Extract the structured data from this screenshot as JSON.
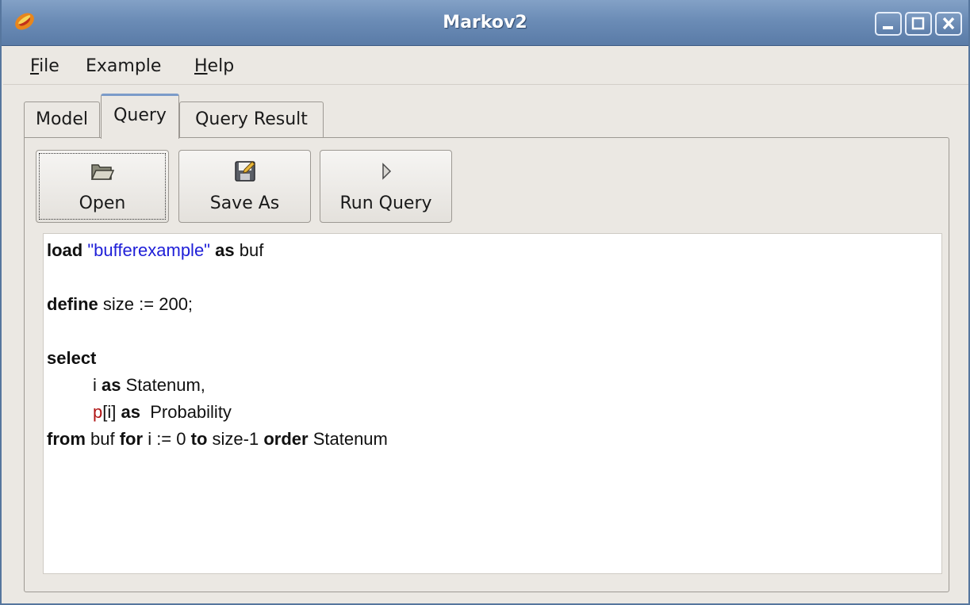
{
  "window": {
    "title": "Markov2",
    "icon": "markov-app-icon",
    "controls": [
      "minimize-icon",
      "maximize-icon",
      "close-icon"
    ]
  },
  "menu": {
    "file": {
      "mnemonic": "F",
      "rest": "ile"
    },
    "example": "Example",
    "help": {
      "mnemonic": "H",
      "rest": "elp"
    }
  },
  "tabs": {
    "model": "Model",
    "query": "Query",
    "query_result": "Query Result",
    "active": "Query"
  },
  "toolbar": {
    "open": {
      "label": "Open",
      "icon": "folder-open-icon"
    },
    "save_as": {
      "label": "Save As",
      "icon": "floppy-save-icon"
    },
    "run_query": {
      "label": "Run Query",
      "icon": "play-arrow-icon"
    }
  },
  "editor": {
    "l1": {
      "kw1": "load",
      "str": "\"bufferexample\"",
      "kw2": "as",
      "t": "buf"
    },
    "l2": {
      "kw": "define",
      "t": "size := 200;"
    },
    "l3": {
      "kw": "select"
    },
    "l4": {
      "t1": "i",
      "kw": "as",
      "t2": "Statenum,"
    },
    "l5": {
      "red": "p",
      "t1": "[i]",
      "kw": "as",
      "t2": "Probability"
    },
    "l6": {
      "kw1": "from",
      "t1": "buf",
      "kw2": "for",
      "t2": "i := 0",
      "kw3": "to",
      "t3": "size-1",
      "kw4": "order",
      "t4": "Statenum"
    }
  },
  "colors": {
    "titlebar": "#6b8cb6",
    "keyword_string": "#2020d8",
    "keyword_red": "#b01515",
    "window_bg": "#ebe8e3"
  }
}
